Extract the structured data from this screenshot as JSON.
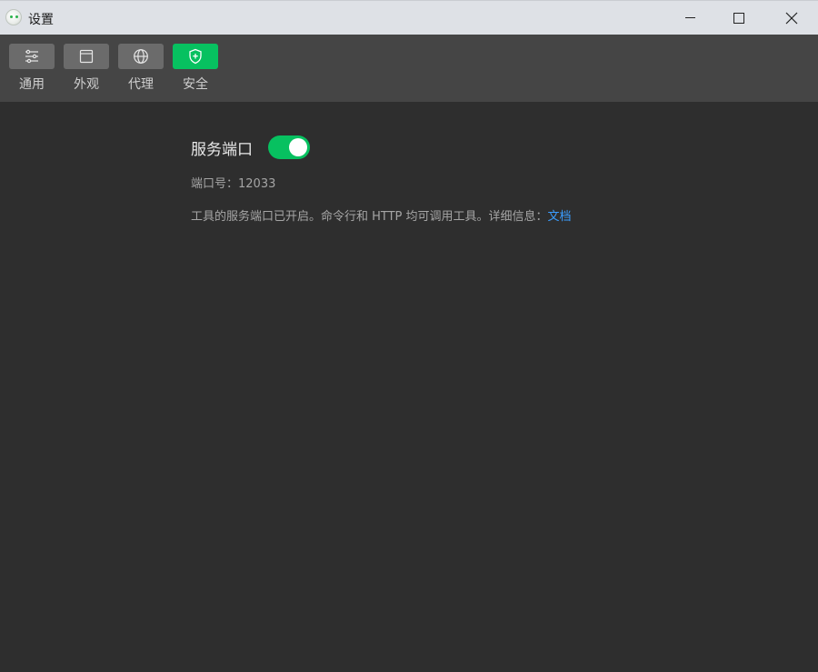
{
  "window": {
    "title": "设置",
    "app_icon": "wechat-devtools-icon"
  },
  "window_controls": {
    "minimize_icon": "minimize-icon",
    "maximize_icon": "maximize-icon",
    "close_icon": "close-icon"
  },
  "toolbar": {
    "items": [
      {
        "label": "通用",
        "icon": "sliders-icon",
        "active": false
      },
      {
        "label": "外观",
        "icon": "window-icon",
        "active": false
      },
      {
        "label": "代理",
        "icon": "globe-icon",
        "active": false
      },
      {
        "label": "安全",
        "icon": "shield-icon",
        "active": true
      }
    ]
  },
  "security": {
    "service_port": {
      "title": "服务端口",
      "enabled": true,
      "port_label": "端口号：",
      "port_value": "12033",
      "description": "工具的服务端口已开启。命令行和 HTTP 均可调用工具。详细信息：",
      "doc_link": "文档"
    }
  },
  "colors": {
    "accent": "#07c160",
    "link": "#3b9dff",
    "background": "#2e2e2e",
    "toolbar": "#454545",
    "titlebar": "#dee1e6"
  }
}
